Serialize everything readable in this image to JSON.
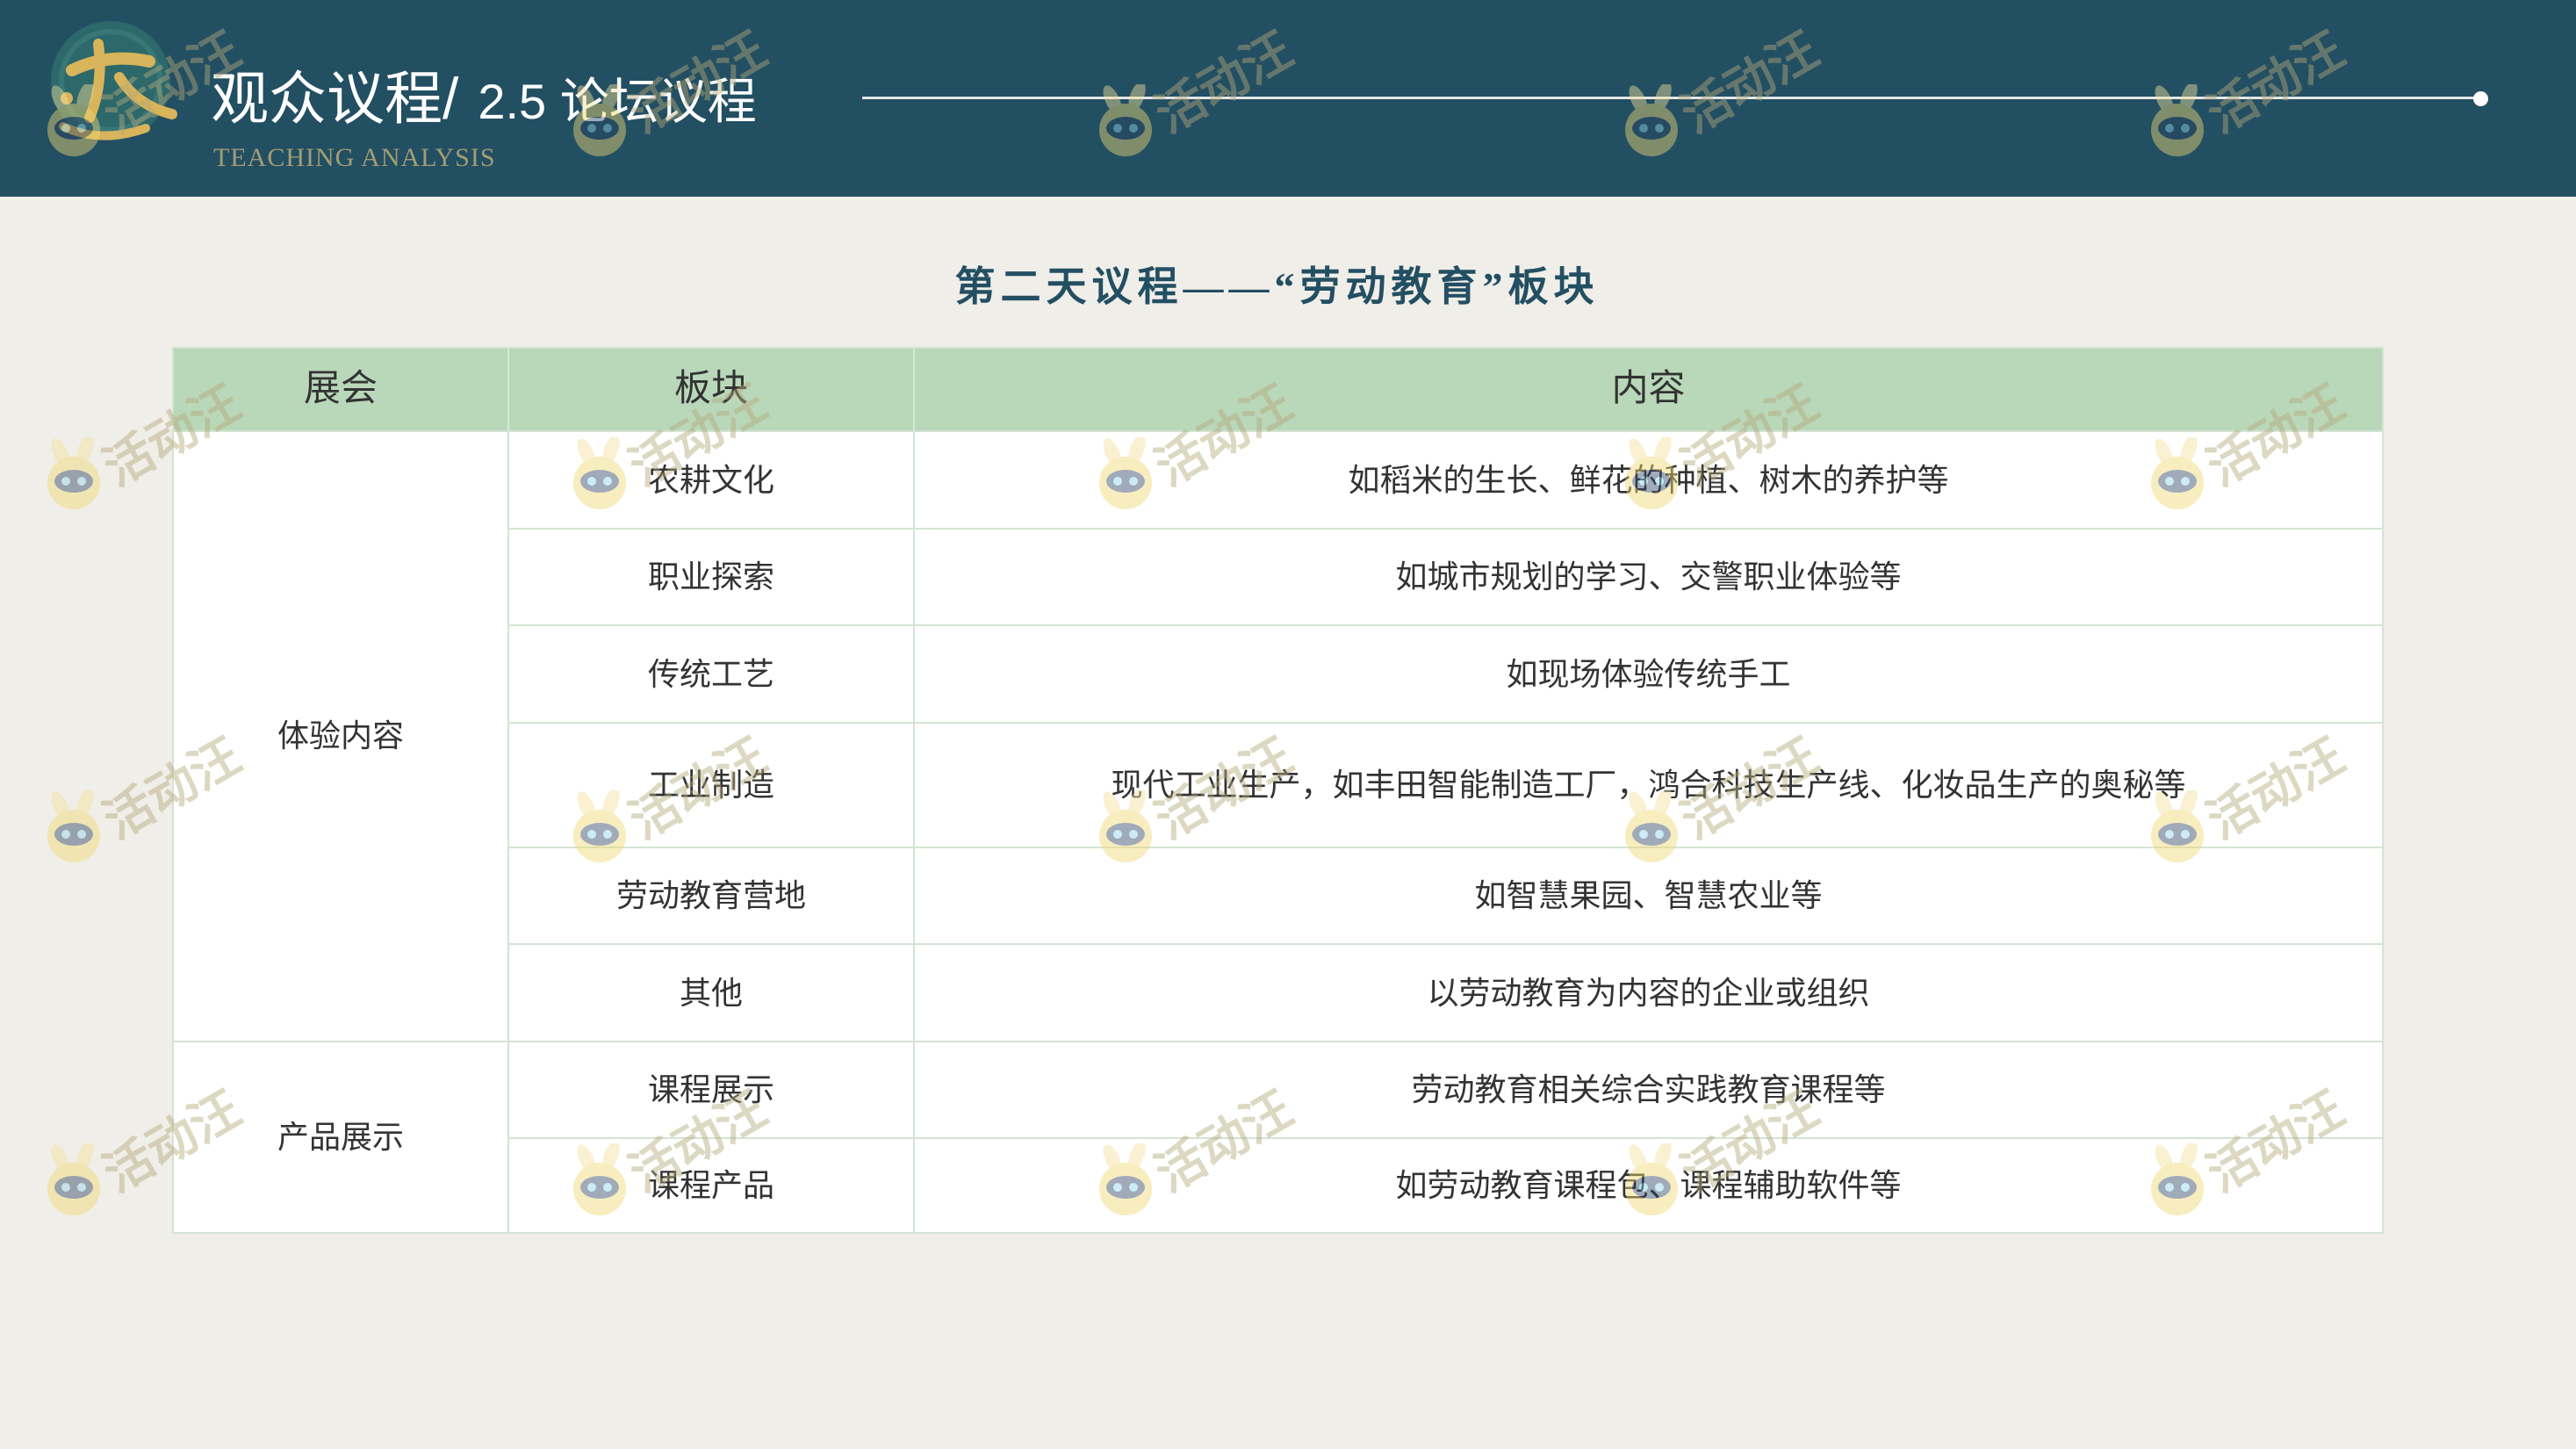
{
  "header": {
    "title_main": "观众议程/",
    "title_sub": "2.5 论坛议程",
    "subtitle": "TEACHING ANALYSIS"
  },
  "section_title": "第二天议程——“劳动教育”板块",
  "table": {
    "headers": [
      "展会",
      "板块",
      "内容"
    ],
    "groups": [
      {
        "name": "体验内容",
        "rows": [
          {
            "block": "农耕文化",
            "content": "如稻米的生长、鲜花的种植、树木的养护等"
          },
          {
            "block": "职业探索",
            "content": "如城市规划的学习、交警职业体验等"
          },
          {
            "block": "传统工艺",
            "content": "如现场体验传统手工"
          },
          {
            "block": "工业制造",
            "content": "现代工业生产，如丰田智能制造工厂，鸿合科技生产线、化妆品生产的奥秘等"
          },
          {
            "block": "劳动教育营地",
            "content": "如智慧果园、智慧农业等"
          },
          {
            "block": "其他",
            "content": "以劳动教育为内容的企业或组织"
          }
        ]
      },
      {
        "name": "产品展示",
        "rows": [
          {
            "block": "课程展示",
            "content": "劳动教育相关综合实践教育课程等"
          },
          {
            "block": "课程产品",
            "content": "如劳动教育课程包、课程辅助软件等"
          }
        ]
      }
    ]
  },
  "watermark": {
    "text": "活动汪",
    "icon": "mascot-icon"
  },
  "icons": {
    "logo": "calligraphy-logo-icon",
    "divider_end": "dot-icon"
  },
  "colors": {
    "header_bg": "#234f63",
    "page_bg": "#f0eee8",
    "table_header_bg": "#b9d8ba",
    "table_border": "#d3e4d3",
    "section_title": "#234f63",
    "logo_gold": "#d8b45a"
  }
}
